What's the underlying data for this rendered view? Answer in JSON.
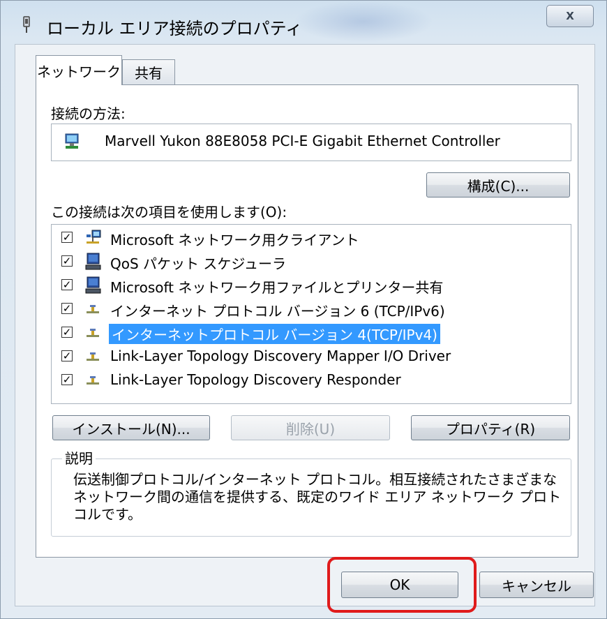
{
  "window": {
    "title": "ローカル エリア接続のプロパティ",
    "close_glyph": "X"
  },
  "tabs": [
    {
      "label": "ネットワーク",
      "active": true
    },
    {
      "label": "共有",
      "active": false
    }
  ],
  "connection": {
    "label": "接続の方法:",
    "adapter": "Marvell Yukon 88E8058 PCI-E Gigabit Ethernet Controller",
    "configure_button": "構成(C)..."
  },
  "items_section": {
    "label": "この接続は次の項目を使用します(O):",
    "items": [
      {
        "label": "Microsoft ネットワーク用クライアント",
        "checked": true,
        "icon": "network-client-icon",
        "selected": false
      },
      {
        "label": "QoS パケット スケジューラ",
        "checked": true,
        "icon": "computer-service-icon",
        "selected": false
      },
      {
        "label": "Microsoft ネットワーク用ファイルとプリンター共有",
        "checked": true,
        "icon": "computer-service-icon",
        "selected": false
      },
      {
        "label": "インターネット プロトコル バージョン 6 (TCP/IPv6)",
        "checked": true,
        "icon": "protocol-icon",
        "selected": false
      },
      {
        "label": "インターネットプロトコル バージョン 4(TCP/IPv4)",
        "checked": true,
        "icon": "protocol-icon",
        "selected": true
      },
      {
        "label": "Link-Layer Topology Discovery Mapper I/O Driver",
        "checked": true,
        "icon": "protocol-icon",
        "selected": false
      },
      {
        "label": "Link-Layer Topology Discovery Responder",
        "checked": true,
        "icon": "protocol-icon",
        "selected": false
      }
    ],
    "checkmark": "✓"
  },
  "buttons": {
    "install": "インストール(N)...",
    "uninstall": "削除(U)",
    "properties": "プロパティ(R)",
    "ok": "OK",
    "cancel": "キャンセル"
  },
  "description": {
    "label": "説明",
    "text": "伝送制御プロトコル/インターネット プロトコル。相互接続されたさまざまなネットワーク間の通信を提供する、既定のワイド エリア ネットワーク プロトコルです。"
  },
  "colors": {
    "selection": "#3399ff",
    "highlight_annotation": "#e01b1b"
  }
}
